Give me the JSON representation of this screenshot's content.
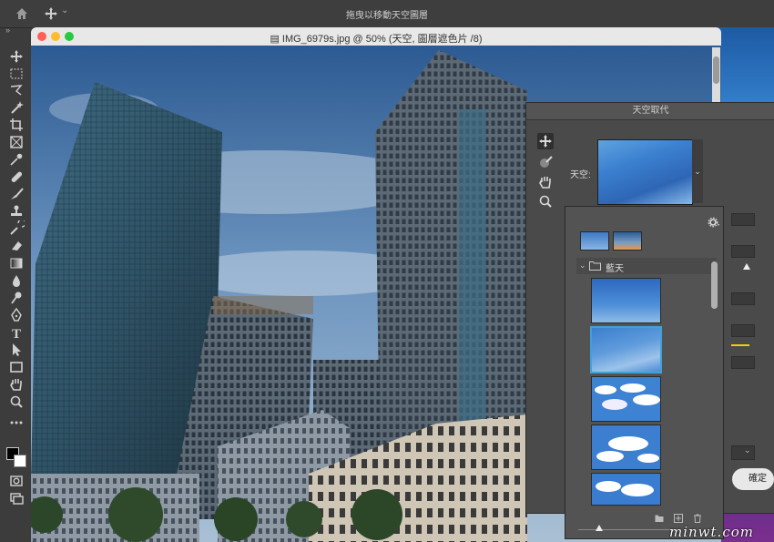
{
  "app": {
    "title": "拖曳以移動天空圖層"
  },
  "document": {
    "title": "IMG_6979s.jpg @ 50% (天空, 圖層遮色片 /8)"
  },
  "toolbar": {
    "tools": [
      "move-icon",
      "marquee-icon",
      "lasso-icon",
      "magic-wand-icon",
      "crop-icon",
      "frame-icon",
      "eyedropper-icon",
      "healing-icon",
      "brush-icon",
      "stamp-icon",
      "history-brush-icon",
      "eraser-icon",
      "gradient-icon",
      "blur-icon",
      "dodge-icon",
      "pen-icon",
      "type-icon",
      "path-select-icon",
      "rectangle-icon",
      "hand-icon",
      "zoom-icon",
      "more-icon"
    ]
  },
  "sky_dialog": {
    "title": "天空取代",
    "sky_label": "天空:",
    "ok_label": "確定",
    "folder_label": "藍天"
  },
  "colors": {
    "selection": "#3fa2d9",
    "accent_yellow": "#f0d000",
    "sky": "#3b80cf"
  },
  "watermark": "minwt.com"
}
